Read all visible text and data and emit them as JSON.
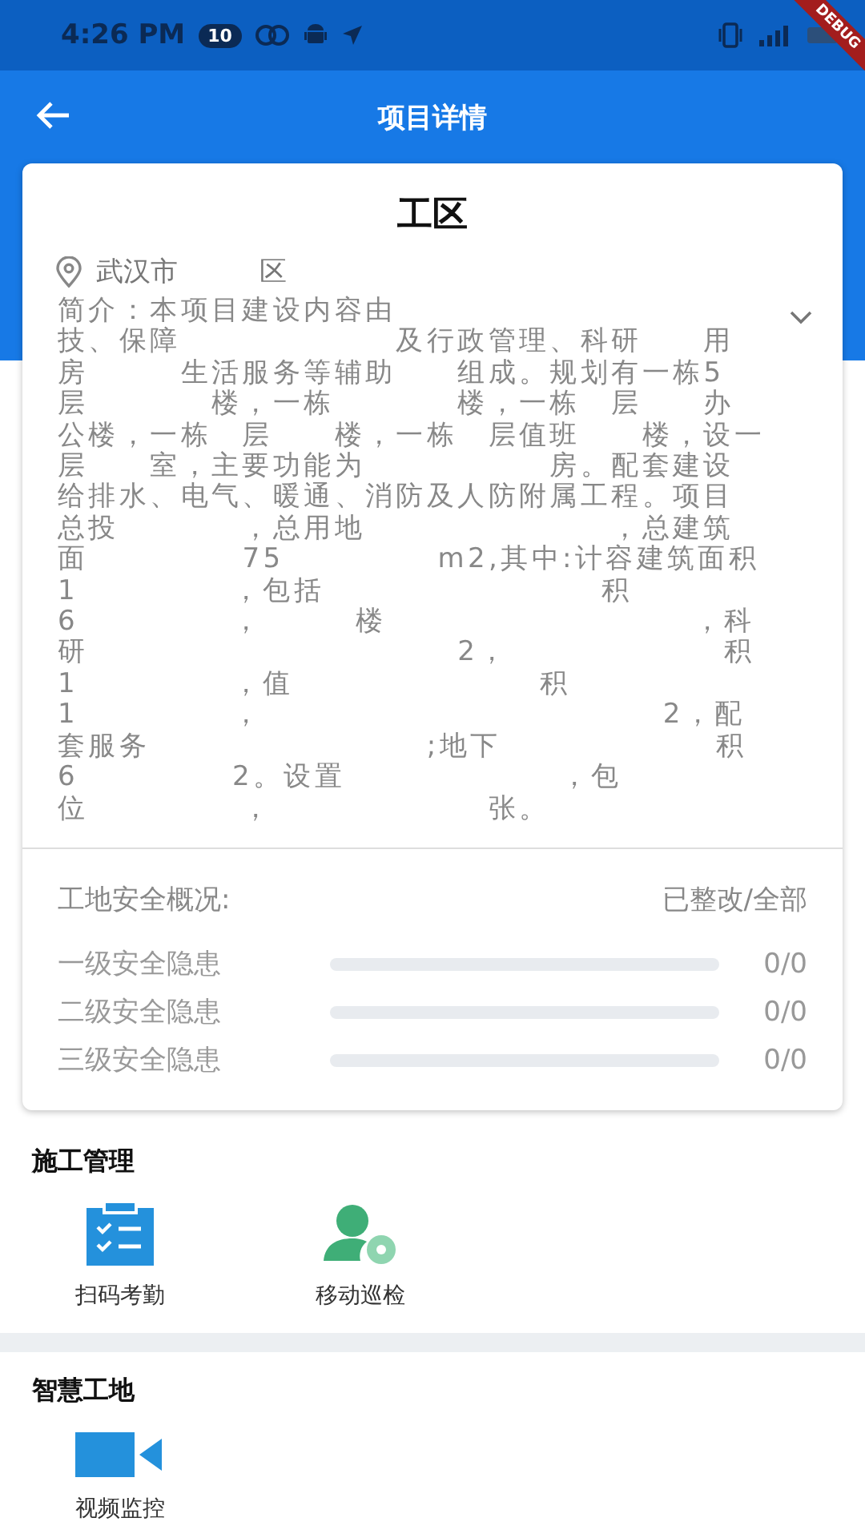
{
  "status_bar": {
    "time": "4:26 PM",
    "badge": "10",
    "debug_banner": "DEBUG"
  },
  "app_bar": {
    "title": "项目详情"
  },
  "project": {
    "name": "工区",
    "location": "武汉市　　　区",
    "description": [
      "简介：本项目建设内容由",
      "技、保障　　　　　　　及行政管理、科研　　用",
      "房　　　生活服务等辅助　　组成。规划有一栋5",
      "层　　　　楼，一栋　　　　楼，一栋　层　　办",
      "公楼，一栋　层　　楼，一栋　层值班　　楼，设一",
      "层　　室，主要功能为　　　　　　房。配套建设",
      "给排水、电气、暖通、消防及人防附属工程。项目",
      "总投　　　　，总用地　　　　　　　　，总建筑",
      "面　　　　　75　　　　　m2,其中:计容建筑面积",
      "1　　　　　，包括　　　　　　　　　积",
      "6　　　　　，　　　楼　　　　　　　　　　，科",
      "研　　　　　　　　　　　　2，　　　　　　　积",
      "1　　　　　，值　　　　　　　　积",
      "1　　　　　，　　　　　　　　　　　　　2，配",
      "套服务　　　　　　　　　;地下　　　　　　　积",
      "6　　　　　2。设置　　　　　　　，包",
      "位　　　　　，　　　　　　　张。"
    ]
  },
  "safety": {
    "title": "工地安全概况:",
    "legend": "已整改/全部",
    "rows": [
      {
        "label": "一级安全隐患",
        "level": 0,
        "reading": "0/0"
      },
      {
        "label": "二级安全隐患",
        "level": 0,
        "reading": "0/0"
      },
      {
        "label": "三级安全隐患",
        "level": 0,
        "reading": "0/0"
      }
    ]
  },
  "sections": [
    {
      "title": "施工管理",
      "items": [
        {
          "kind": "checklist",
          "label": "扫码考勤"
        },
        {
          "kind": "patrol",
          "label": "移动巡检"
        }
      ]
    },
    {
      "title": "智慧工地",
      "items": [
        {
          "kind": "camera",
          "label": "视频监控"
        }
      ]
    }
  ]
}
